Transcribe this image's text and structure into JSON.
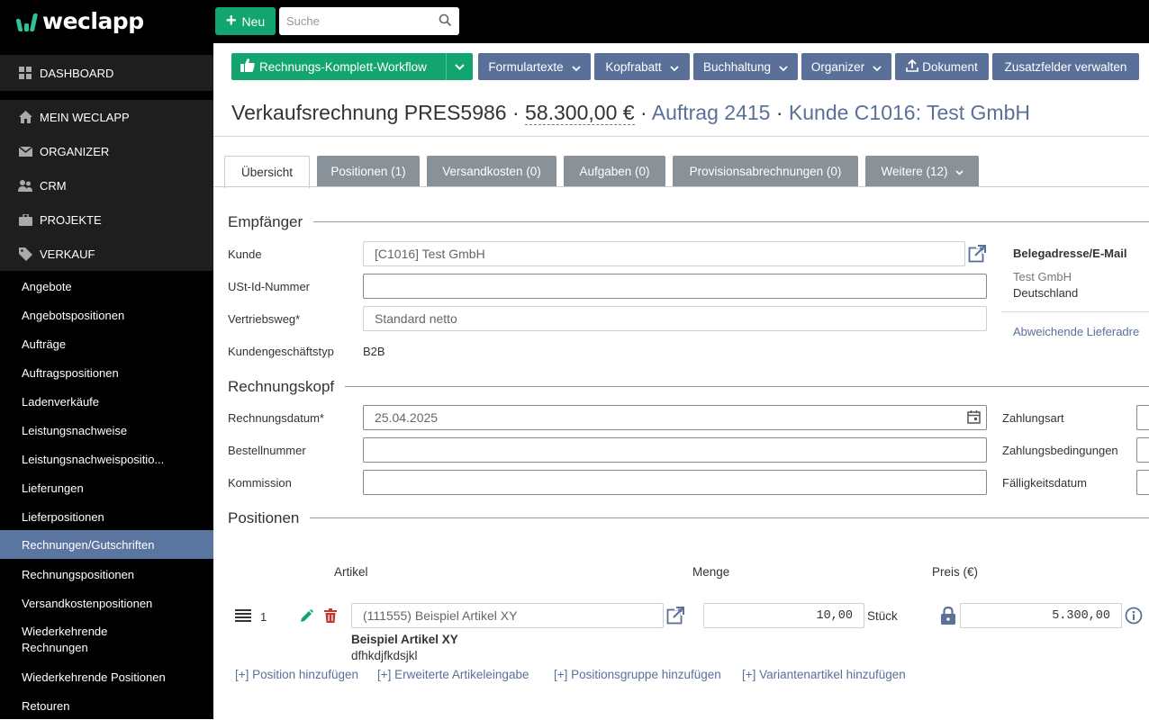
{
  "app": {
    "brand": "weclapp",
    "accent": "#13a56f",
    "sidebar_active": "#5b75a1"
  },
  "topbar": {
    "new_label": "Neu",
    "search_placeholder": "Suche"
  },
  "sidebar": {
    "main": [
      {
        "label": "DASHBOARD",
        "icon": "dashboard-icon"
      },
      {
        "label": "MEIN WECLAPP",
        "icon": "home-icon"
      },
      {
        "label": "ORGANIZER",
        "icon": "mail-icon"
      },
      {
        "label": "CRM",
        "icon": "users-icon"
      },
      {
        "label": "PROJEKTE",
        "icon": "briefcase-icon"
      },
      {
        "label": "VERKAUF",
        "icon": "tag-icon"
      }
    ],
    "sub": [
      "Angebote",
      "Angebotspositionen",
      "Aufträge",
      "Auftragspositionen",
      "Ladenverkäufe",
      "Leistungsnachweise",
      "Leistungsnachweispositio...",
      "Lieferungen",
      "Lieferpositionen",
      "Rechnungen/Gutschriften",
      "Rechnungspositionen",
      "Versandkostenpositionen",
      "Wiederkehrende Rechnungen",
      "Wiederkehrende Positionen",
      "Retouren"
    ]
  },
  "toolbar": {
    "workflow": "Rechnungs-Komplett-Workflow",
    "formulartexte": "Formulartexte",
    "kopfrabatt": "Kopfrabatt",
    "buchhaltung": "Buchhaltung",
    "organizer": "Organizer",
    "dokument": "Dokument",
    "zusatzfelder": "Zusatzfelder verwalten"
  },
  "title": {
    "main": "Verkaufsrechnung PRES5986",
    "dot": " · ",
    "amount": "58.300,00 €",
    "auftrag": "Auftrag 2415",
    "kunde": "Kunde C1016: Test GmbH"
  },
  "tabs": [
    "Übersicht",
    "Positionen (1)",
    "Versandkosten (0)",
    "Aufgaben (0)",
    "Provisionsabrechnungen (0)",
    "Weitere (12)"
  ],
  "empfaenger": {
    "title": "Empfänger",
    "kunde_label": "Kunde",
    "kunde_value": "[C1016] Test GmbH",
    "ust_label": "USt-Id-Nummer",
    "ust_value": "",
    "vertrieb_label": "Vertriebsweg*",
    "vertrieb_value": "Standard netto",
    "typ_label": "Kundengeschäftstyp",
    "typ_value": "B2B",
    "beleg_title": "Belegadresse/E-Mail",
    "beleg_line1": "Test GmbH",
    "beleg_line2": "Deutschland",
    "abweichend": "Abweichende Lieferadre"
  },
  "kopf": {
    "title": "Rechnungskopf",
    "datum_label": "Rechnungsdatum*",
    "datum_value": "25.04.2025",
    "bestell_label": "Bestellnummer",
    "bestell_value": "",
    "kommission_label": "Kommission",
    "kommission_value": "",
    "zahlungsart_label": "Zahlungsart",
    "zahlungsbed_label": "Zahlungsbedingungen",
    "faellig_label": "Fälligkeitsdatum"
  },
  "positionen": {
    "title": "Positionen",
    "col_artikel": "Artikel",
    "col_menge": "Menge",
    "col_preis": "Preis (€)",
    "row": {
      "number": "1",
      "artikel": "(111555) Beispiel Artikel XY",
      "menge": "10,00",
      "unit": "Stück",
      "preis": "5.300,00",
      "name": "Beispiel Artikel XY",
      "desc": "dfhkdjfkdsjkl"
    },
    "links": [
      "[+] Position hinzufügen",
      "[+] Erweiterte Artikeleingabe",
      "[+] Positionsgruppe hinzufügen",
      "[+] Variantenartikel hinzufügen"
    ]
  }
}
